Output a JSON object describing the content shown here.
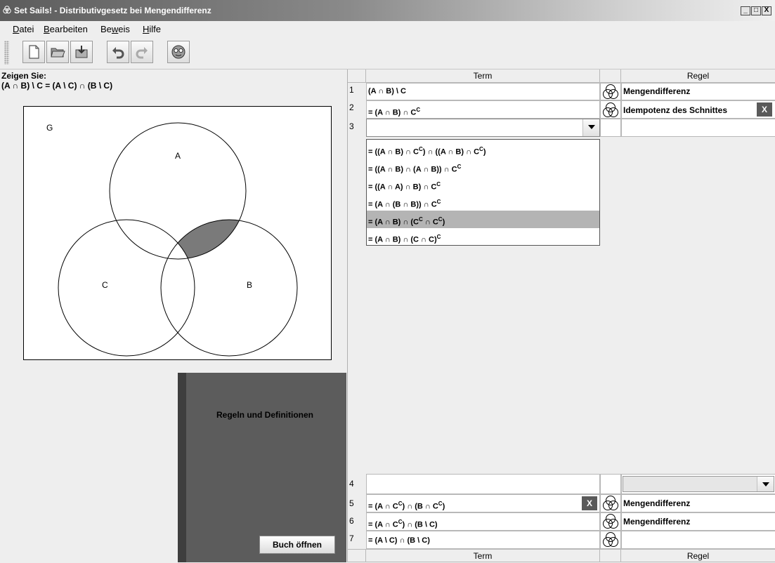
{
  "window": {
    "title": "Set Sails! - Distributivgesetz bei Mengendifferenz",
    "controls": [
      "_",
      "□",
      "X"
    ]
  },
  "menu": [
    {
      "accel": "D",
      "rest": "atei"
    },
    {
      "accel": "B",
      "rest": "earbeiten"
    },
    {
      "pre": "Be",
      "accel": "w",
      "rest": "eis"
    },
    {
      "accel": "H",
      "rest": "ilfe"
    }
  ],
  "toolbar": {
    "buttons": [
      "new-document-icon",
      "open-folder-icon",
      "save-icon",
      "undo-icon",
      "redo-icon",
      "help-face-icon"
    ]
  },
  "task": {
    "heading": "Zeigen Sie:",
    "statement": "(A ∩ B) \\ C = (A \\ C) ∩ (B \\ C)"
  },
  "venn": {
    "universe_label": "G",
    "labels": {
      "A": "A",
      "B": "B",
      "C": "C"
    },
    "shaded_region": "A ∩ B \\ C",
    "shade_color": "#7a7a7a"
  },
  "book": {
    "title": "Regeln und Definitionen",
    "open_label": "Buch öffnen"
  },
  "table": {
    "header_term": "Term",
    "header_rule": "Regel",
    "rows_top": [
      {
        "num": "1",
        "term": "(A ∩ B) \\ C",
        "rule": "Mengendifferenz",
        "has_x": false
      },
      {
        "num": "2",
        "term": "= (A ∩ B) ∩ C",
        "term_sup": "C",
        "rule": "Idempotenz des Schnittes",
        "has_x": true
      },
      {
        "num": "3",
        "term": "",
        "rule": "",
        "combo": true
      }
    ],
    "dropdown_options": [
      {
        "parts": [
          "= ((A ∩ B) ∩ C",
          "C",
          ") ∩ ((A ∩ B) ∩ C",
          "C",
          ")"
        ]
      },
      {
        "parts": [
          "= ((A ∩ B) ∩ (A ∩ B)) ∩ C",
          "C"
        ]
      },
      {
        "parts": [
          "= ((A ∩ A) ∩ B) ∩ C",
          "C"
        ]
      },
      {
        "parts": [
          "= (A ∩ (B ∩ B)) ∩ C",
          "C"
        ]
      },
      {
        "parts": [
          "= (A ∩ B) ∩ (C",
          "C",
          " ∩ C",
          "C",
          ")"
        ],
        "selected": true
      },
      {
        "parts": [
          "= (A ∩ B) ∩ (C ∩ C)",
          "C"
        ]
      }
    ],
    "rows_bottom": [
      {
        "num": "4",
        "term": "",
        "rule": "",
        "rule_combo": true
      },
      {
        "num": "5",
        "term": "= (A ∩ C",
        "sup1": "C",
        "term_mid": ") ∩ (B ∩ C",
        "sup2": "C",
        "term_end": ")",
        "rule": "Mengendifferenz",
        "has_x": true
      },
      {
        "num": "6",
        "term": "= (A ∩ C",
        "sup1": "C",
        "term_mid": ") ∩ (B \\ C)",
        "rule": "Mengendifferenz"
      },
      {
        "num": "7",
        "term": "= (A \\ C) ∩ (B \\ C)",
        "rule": ""
      }
    ],
    "x_label": "X"
  }
}
